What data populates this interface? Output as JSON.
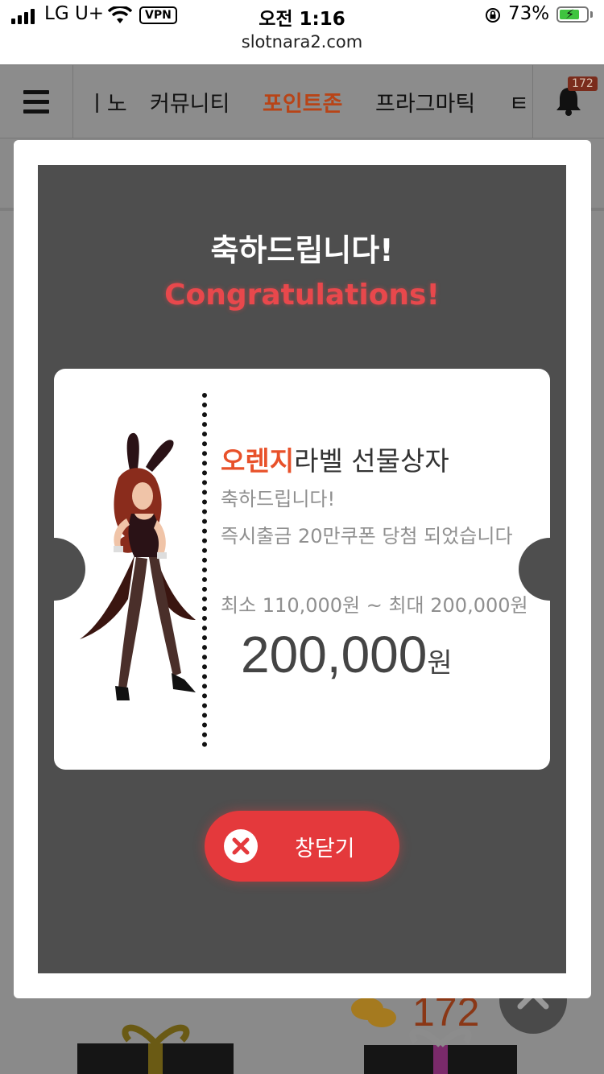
{
  "status_bar": {
    "carrier": "LG U+",
    "vpn": "VPN",
    "time": "오전 1:16",
    "url": "slotnara2.com",
    "battery": "73%"
  },
  "nav": {
    "items": [
      "ㅣ노",
      "커뮤니티",
      "포인트존",
      "프라그마틱",
      "ㅌ"
    ],
    "active_index": 2,
    "badge": "172"
  },
  "modal": {
    "title": "축하드립니다!",
    "subtitle": "Congratulations!",
    "card": {
      "brand": "오렌지",
      "title_rest": "라벨 선물상자",
      "line1": "축하드립니다!",
      "line2": "즉시출금 20만쿠폰 당첨 되었습니다",
      "line3": "최소 110,000원 ~ 최대 200,000원",
      "amount": "200,000",
      "unit": "원"
    },
    "close_label": "창닫기"
  },
  "background": {
    "count": "172"
  },
  "colors": {
    "accent": "#e4393c",
    "brand": "#e8512a",
    "modal_bg": "#4e4e4e"
  }
}
